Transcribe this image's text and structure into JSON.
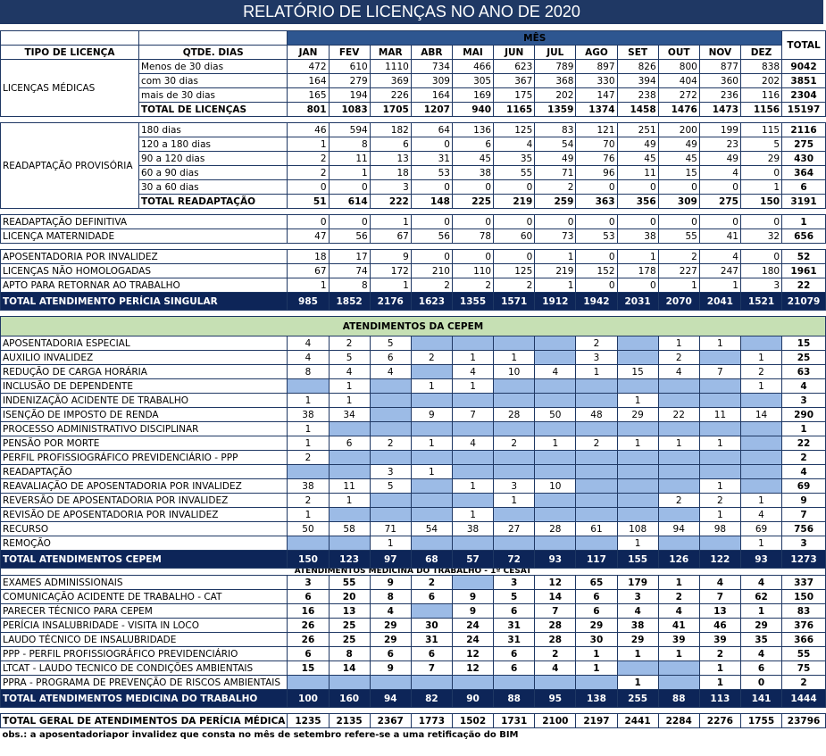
{
  "title": "RELATÓRIO DE  LICENÇAS NO ANO DE 2020",
  "header": {
    "col_tipo": "TIPO DE LICENÇA",
    "col_qtde": "QTDE. DIAS",
    "mes_label": "MÊS",
    "total_label": "TOTAL",
    "months": [
      "JAN",
      "FEV",
      "MAR",
      "ABR",
      "MAI",
      "JUN",
      "JUL",
      "AGO",
      "SET",
      "OUT",
      "NOV",
      "DEZ"
    ]
  },
  "colors": {
    "title_bg": "#1f3864",
    "dark_row": "#0d2558",
    "fill": "#9cbbe6",
    "section_bg": "#c6e0b4"
  },
  "licencas_medicas": {
    "label": "LICENÇAS MÉDICAS",
    "rows": [
      {
        "sub": "Menos de 30 dias",
        "v": [
          "472",
          "610",
          "1110",
          "734",
          "466",
          "623",
          "789",
          "897",
          "826",
          "800",
          "877",
          "838"
        ],
        "total": "9042"
      },
      {
        "sub": "com 30 dias",
        "v": [
          "164",
          "279",
          "369",
          "309",
          "305",
          "367",
          "368",
          "330",
          "394",
          "404",
          "360",
          "202"
        ],
        "total": "3851"
      },
      {
        "sub": "mais de 30 dias",
        "v": [
          "165",
          "194",
          "226",
          "164",
          "169",
          "175",
          "202",
          "147",
          "238",
          "272",
          "236",
          "116"
        ],
        "total": "2304"
      }
    ],
    "total_row": {
      "sub": "TOTAL DE LICENÇAS",
      "v": [
        "801",
        "1083",
        "1705",
        "1207",
        "940",
        "1165",
        "1359",
        "1374",
        "1458",
        "1476",
        "1473",
        "1156"
      ],
      "total": "15197"
    }
  },
  "readaptacao": {
    "label": "READAPTAÇÃO PROVISÓRIA",
    "rows": [
      {
        "sub": "180 dias",
        "v": [
          "46",
          "594",
          "182",
          "64",
          "136",
          "125",
          "83",
          "121",
          "251",
          "200",
          "199",
          "115"
        ],
        "total": "2116"
      },
      {
        "sub": "120 a 180 dias",
        "v": [
          "1",
          "8",
          "6",
          "0",
          "6",
          "4",
          "54",
          "70",
          "49",
          "49",
          "23",
          "5"
        ],
        "total": "275"
      },
      {
        "sub": "90 a 120 dias",
        "v": [
          "2",
          "11",
          "13",
          "31",
          "45",
          "35",
          "49",
          "76",
          "45",
          "45",
          "49",
          "29"
        ],
        "total": "430"
      },
      {
        "sub": "60 a 90 dias",
        "v": [
          "2",
          "1",
          "18",
          "53",
          "38",
          "55",
          "71",
          "96",
          "11",
          "15",
          "4",
          "0"
        ],
        "total": "364"
      },
      {
        "sub": "30 a 60 dias",
        "v": [
          "0",
          "0",
          "3",
          "0",
          "0",
          "0",
          "2",
          "0",
          "0",
          "0",
          "0",
          "1"
        ],
        "total": "6"
      }
    ],
    "total_row": {
      "sub": "TOTAL READAPTAÇÃO",
      "v": [
        "51",
        "614",
        "222",
        "148",
        "225",
        "219",
        "259",
        "363",
        "356",
        "309",
        "275",
        "150"
      ],
      "total": "3191"
    }
  },
  "group2": [
    {
      "label": "READAPTAÇÃO DEFINITIVA",
      "v": [
        "0",
        "0",
        "1",
        "0",
        "0",
        "0",
        "0",
        "0",
        "0",
        "0",
        "0",
        "0"
      ],
      "total": "1"
    },
    {
      "label": "LICENÇA MATERNIDADE",
      "v": [
        "47",
        "56",
        "67",
        "56",
        "78",
        "60",
        "73",
        "53",
        "38",
        "55",
        "41",
        "32"
      ],
      "total": "656"
    }
  ],
  "group3": [
    {
      "label": "APOSENTADORIA POR INVALIDEZ",
      "v": [
        "18",
        "17",
        "9",
        "0",
        "0",
        "0",
        "1",
        "0",
        "1",
        "2",
        "4",
        "0"
      ],
      "total": "52"
    },
    {
      "label": "LICENÇAS NÃO HOMOLOGADAS",
      "v": [
        "67",
        "74",
        "172",
        "210",
        "110",
        "125",
        "219",
        "152",
        "178",
        "227",
        "247",
        "180"
      ],
      "total": "1961"
    },
    {
      "label": "APTO PARA RETORNAR AO TRABALHO",
      "v": [
        "1",
        "8",
        "1",
        "2",
        "2",
        "2",
        "1",
        "0",
        "0",
        "1",
        "1",
        "3"
      ],
      "total": "22"
    }
  ],
  "total_singular": {
    "label": "TOTAL ATENDIMENTO PERÍCIA SINGULAR",
    "v": [
      "985",
      "1852",
      "2176",
      "1623",
      "1355",
      "1571",
      "1912",
      "1942",
      "2031",
      "2070",
      "2041",
      "1521"
    ],
    "total": "21079"
  },
  "cepem": {
    "section_label": "ATENDIMENTOS DA CEPEM",
    "rows": [
      {
        "label": "APOSENTADORIA ESPECIAL",
        "v": [
          "4",
          "2",
          "5",
          "",
          "",
          "",
          "",
          "2",
          "",
          "1",
          "1",
          ""
        ],
        "total": "15"
      },
      {
        "label": "AUXILIO INVALIDEZ",
        "v": [
          "4",
          "5",
          "6",
          "2",
          "1",
          "1",
          "",
          "3",
          "",
          "2",
          "",
          "1"
        ],
        "total": "25"
      },
      {
        "label": "REDUÇÃO DE CARGA HORÁRIA",
        "v": [
          "8",
          "4",
          "4",
          "",
          "4",
          "10",
          "4",
          "1",
          "15",
          "4",
          "7",
          "2"
        ],
        "total": "63"
      },
      {
        "label": "INCLUSÃO DE DEPENDENTE",
        "v": [
          "",
          "1",
          "",
          "1",
          "1",
          "",
          "",
          "",
          "",
          "",
          "",
          "1"
        ],
        "total": "4"
      },
      {
        "label": "INDENIZAÇÃO ACIDENTE DE TRABALHO",
        "v": [
          "1",
          "1",
          "",
          "",
          "",
          "",
          "",
          "",
          "1",
          "",
          "",
          ""
        ],
        "total": "3"
      },
      {
        "label": "ISENÇÃO DE IMPOSTO DE RENDA",
        "v": [
          "38",
          "34",
          "",
          "9",
          "7",
          "28",
          "50",
          "48",
          "29",
          "22",
          "11",
          "14"
        ],
        "total": "290"
      },
      {
        "label": "PROCESSO ADMINISTRATIVO DISCIPLINAR",
        "v": [
          "1",
          "",
          "",
          "",
          "",
          "",
          "",
          "",
          "",
          "",
          "",
          ""
        ],
        "total": "1"
      },
      {
        "label": "PENSÃO POR MORTE",
        "v": [
          "1",
          "6",
          "2",
          "1",
          "4",
          "2",
          "1",
          "2",
          "1",
          "1",
          "1",
          ""
        ],
        "total": "22"
      },
      {
        "label": "PERFIL PROFISSIOGRÁFICO PREVIDENCIÁRIO - PPP",
        "v": [
          "2",
          "",
          "",
          "",
          "",
          "",
          "",
          "",
          "",
          "",
          "",
          ""
        ],
        "total": "2"
      },
      {
        "label": "READAPTAÇÃO",
        "v": [
          "",
          "",
          "3",
          "1",
          "",
          "",
          "",
          "",
          "",
          "",
          "",
          ""
        ],
        "total": "4"
      },
      {
        "label": "REAVALIAÇÃO DE APOSENTADORIA POR INVALIDEZ",
        "v": [
          "38",
          "11",
          "5",
          "",
          "1",
          "3",
          "10",
          "",
          "",
          "",
          "1",
          ""
        ],
        "total": "69"
      },
      {
        "label": "REVERSÃO DE APOSENTADORIA POR INVALIDEZ",
        "v": [
          "2",
          "1",
          "",
          "",
          "",
          "1",
          "",
          "",
          "",
          "2",
          "2",
          "1"
        ],
        "total": "9"
      },
      {
        "label": "REVISÃO DE APOSENTADORIA POR INVALIDEZ",
        "v": [
          "1",
          "",
          "",
          "",
          "1",
          "",
          "",
          "",
          "",
          "",
          "1",
          "4"
        ],
        "total": "7"
      },
      {
        "label": "RECURSO",
        "v": [
          "50",
          "58",
          "71",
          "54",
          "38",
          "27",
          "28",
          "61",
          "108",
          "94",
          "98",
          "69"
        ],
        "total": "756"
      },
      {
        "label": "REMOÇÃO",
        "v": [
          "",
          "",
          "1",
          "",
          "",
          "",
          "",
          "",
          "1",
          "",
          "",
          "1"
        ],
        "total": "3"
      }
    ],
    "fill_mask": [
      [
        0,
        0,
        0,
        1,
        1,
        1,
        1,
        0,
        1,
        0,
        0,
        1
      ],
      [
        0,
        0,
        0,
        0,
        0,
        0,
        1,
        0,
        1,
        0,
        1,
        0
      ],
      [
        0,
        0,
        0,
        1,
        0,
        0,
        0,
        0,
        0,
        0,
        0,
        0
      ],
      [
        1,
        0,
        1,
        0,
        0,
        1,
        1,
        1,
        1,
        1,
        1,
        0
      ],
      [
        0,
        0,
        1,
        1,
        1,
        1,
        1,
        1,
        0,
        1,
        1,
        1
      ],
      [
        0,
        0,
        1,
        0,
        0,
        0,
        0,
        0,
        0,
        0,
        0,
        0
      ],
      [
        0,
        1,
        1,
        1,
        1,
        1,
        1,
        1,
        1,
        1,
        1,
        1
      ],
      [
        0,
        0,
        0,
        0,
        0,
        0,
        0,
        0,
        0,
        0,
        0,
        1
      ],
      [
        0,
        1,
        1,
        1,
        1,
        1,
        1,
        1,
        1,
        1,
        1,
        1
      ],
      [
        1,
        1,
        0,
        0,
        1,
        1,
        1,
        1,
        1,
        1,
        1,
        1
      ],
      [
        0,
        0,
        0,
        1,
        0,
        0,
        0,
        1,
        1,
        1,
        0,
        1
      ],
      [
        0,
        0,
        1,
        1,
        1,
        0,
        1,
        1,
        1,
        0,
        0,
        0
      ],
      [
        0,
        1,
        1,
        1,
        0,
        1,
        1,
        1,
        1,
        1,
        0,
        0
      ],
      [
        0,
        0,
        0,
        0,
        0,
        0,
        0,
        0,
        0,
        0,
        0,
        0
      ],
      [
        1,
        1,
        0,
        1,
        1,
        1,
        1,
        1,
        0,
        1,
        1,
        0
      ]
    ],
    "total_row": {
      "label": "TOTAL ATENDIMENTOS CEPEM",
      "v": [
        "150",
        "123",
        "97",
        "68",
        "57",
        "72",
        "93",
        "117",
        "155",
        "126",
        "122",
        "93"
      ],
      "total": "1273"
    }
  },
  "medicina": {
    "section_label": "ATENDIMENTOS MEDICINA DO TRABALHO - 1º CESAT",
    "rows": [
      {
        "label": "EXAMES ADMINISSIONAIS",
        "v": [
          "3",
          "55",
          "9",
          "2",
          "",
          "3",
          "12",
          "65",
          "179",
          "1",
          "4",
          "4"
        ],
        "total": "337"
      },
      {
        "label": "COMUNICAÇÃO ACIDENTE DE TRABALHO - CAT",
        "v": [
          "6",
          "20",
          "8",
          "6",
          "9",
          "5",
          "14",
          "6",
          "3",
          "2",
          "7",
          "62"
        ],
        "total": "150"
      },
      {
        "label": "PARECER TÉCNICO PARA CEPEM",
        "v": [
          "16",
          "13",
          "4",
          "",
          "9",
          "6",
          "7",
          "6",
          "4",
          "4",
          "13",
          "1"
        ],
        "total": "83"
      },
      {
        "label": "PERÍCIA INSALUBRIDADE - VISITA IN LOCO",
        "v": [
          "26",
          "25",
          "29",
          "30",
          "24",
          "31",
          "28",
          "29",
          "38",
          "41",
          "46",
          "29"
        ],
        "total": "376"
      },
      {
        "label": "LAUDO TÉCNICO DE INSALUBRIDADE",
        "v": [
          "26",
          "25",
          "29",
          "31",
          "24",
          "31",
          "28",
          "30",
          "29",
          "39",
          "39",
          "35"
        ],
        "total": "366"
      },
      {
        "label": "PPP - PERFIL PROFISSIOGRÁFICO PREVIDENCIÁRIO",
        "v": [
          "6",
          "8",
          "6",
          "6",
          "12",
          "6",
          "2",
          "1",
          "1",
          "1",
          "2",
          "4"
        ],
        "total": "55"
      },
      {
        "label": "LTCAT - LAUDO TECNICO DE CONDIÇÕES AMBIENTAIS",
        "v": [
          "15",
          "14",
          "9",
          "7",
          "12",
          "6",
          "4",
          "1",
          "",
          "",
          "1",
          "6"
        ],
        "total": "75"
      },
      {
        "label": "PPRA - PROGRAMA DE PREVENÇÃO DE RISCOS AMBIENTAIS",
        "v": [
          "",
          "",
          "",
          "",
          "",
          "",
          "",
          "",
          "1",
          "",
          "1",
          "0"
        ],
        "total": "2"
      }
    ],
    "fill_mask": [
      [
        0,
        0,
        0,
        0,
        1,
        0,
        0,
        0,
        0,
        0,
        0,
        0
      ],
      [
        0,
        0,
        0,
        0,
        0,
        0,
        0,
        0,
        0,
        0,
        0,
        0
      ],
      [
        0,
        0,
        0,
        1,
        0,
        0,
        0,
        0,
        0,
        0,
        0,
        0
      ],
      [
        0,
        0,
        0,
        0,
        0,
        0,
        0,
        0,
        0,
        0,
        0,
        0
      ],
      [
        0,
        0,
        0,
        0,
        0,
        0,
        0,
        0,
        0,
        0,
        0,
        0
      ],
      [
        0,
        0,
        0,
        0,
        0,
        0,
        0,
        0,
        0,
        0,
        0,
        0
      ],
      [
        0,
        0,
        0,
        0,
        0,
        0,
        0,
        0,
        1,
        1,
        0,
        0
      ],
      [
        1,
        1,
        1,
        1,
        1,
        1,
        1,
        1,
        0,
        1,
        0,
        0
      ]
    ],
    "total_row": {
      "label": "TOTAL ATENDIMENTOS MEDICINA DO TRABALHO",
      "v": [
        "100",
        "160",
        "94",
        "82",
        "90",
        "88",
        "95",
        "138",
        "255",
        "88",
        "113",
        "141"
      ],
      "total": "1444"
    }
  },
  "total_geral": {
    "label": "TOTAL GERAL DE ATENDIMENTOS DA PERÍCIA MÉDICA",
    "v": [
      "1235",
      "2135",
      "2367",
      "1773",
      "1502",
      "1731",
      "2100",
      "2197",
      "2441",
      "2284",
      "2276",
      "1755"
    ],
    "total": "23796"
  },
  "obs": "obs.: a aposentadoriapor invalidez que consta no mês de setembro refere-se a uma retificação do BIM"
}
